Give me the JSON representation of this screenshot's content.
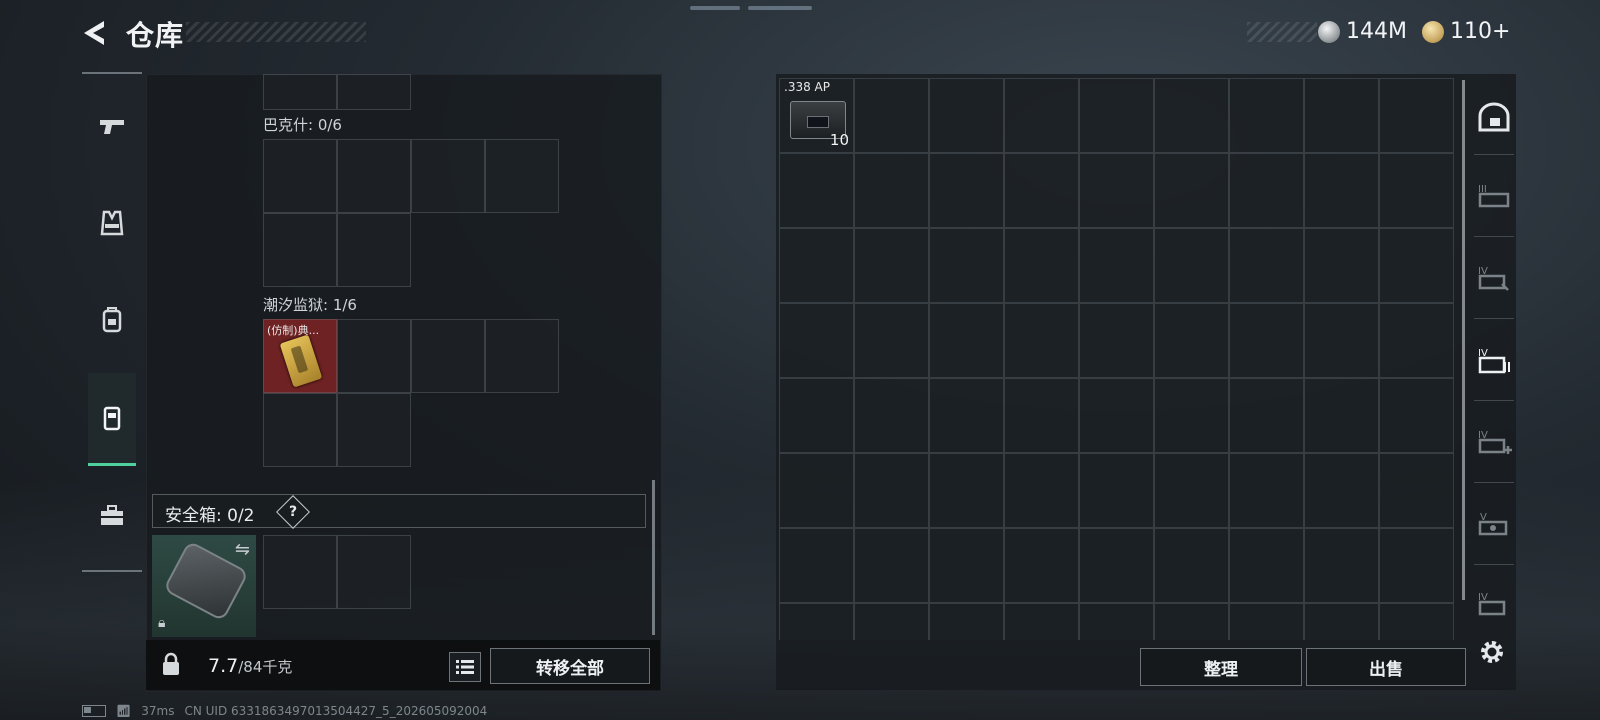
{
  "header": {
    "title": "仓库",
    "currency_silver": "144M",
    "currency_gold": "110+"
  },
  "nav": {
    "items": [
      {
        "id": "weapons",
        "icon": "pistol-icon"
      },
      {
        "id": "armor",
        "icon": "vest-icon"
      },
      {
        "id": "backpack",
        "icon": "backpack-icon"
      },
      {
        "id": "containers",
        "icon": "container-icon",
        "active": true
      },
      {
        "id": "toolbox",
        "icon": "toolbox-icon"
      }
    ]
  },
  "left_panel": {
    "sections": [
      {
        "label": "巴克什: 0/6"
      },
      {
        "label": "潮汐监狱: 1/6",
        "item_label": "(仿制)典..."
      }
    ],
    "safe_box": {
      "label": "安全箱: 0/2",
      "help": "?"
    },
    "weight": {
      "current": "7.7",
      "capacity": "/84千克"
    },
    "transfer_all": "转移全部"
  },
  "stash": {
    "item": {
      "name": ".338 AP",
      "count": "10"
    },
    "sort": "整理",
    "sell": "出售"
  },
  "status": {
    "ping": "37ms",
    "uid": "CN UID 6331863497013504427_5_202605092004"
  },
  "colors": {
    "accent": "#4fcf9d",
    "item_highlight": "#8c2424"
  }
}
